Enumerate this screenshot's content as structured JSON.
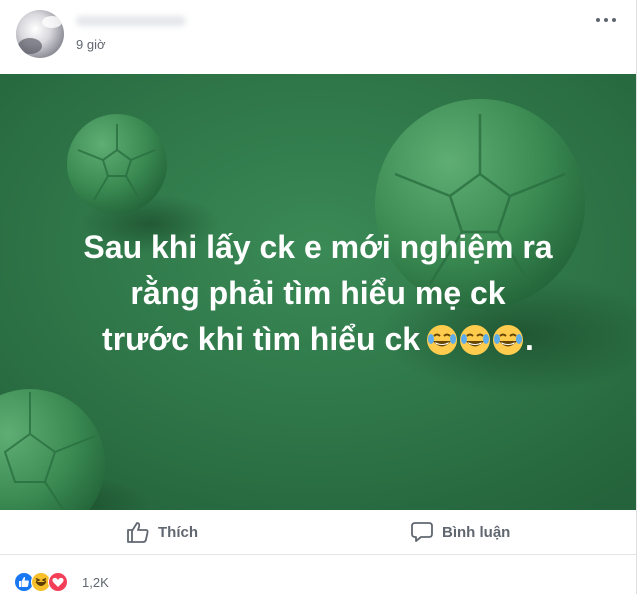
{
  "post": {
    "time": "9 giờ",
    "text_lines": [
      "Sau khi lấy ck e mới nghiệm ra",
      "rằng phải tìm hiểu mẹ ck",
      "trước khi tìm hiểu ck"
    ],
    "text_suffix": ".",
    "emoji": "laugh-cry",
    "colors": {
      "background": "#2c7245",
      "text": "#ffffff"
    }
  },
  "actions": {
    "like_label": "Thích",
    "comment_label": "Bình luận"
  },
  "reactions": {
    "icons": [
      "like",
      "haha",
      "love"
    ],
    "count": "1,2K"
  }
}
